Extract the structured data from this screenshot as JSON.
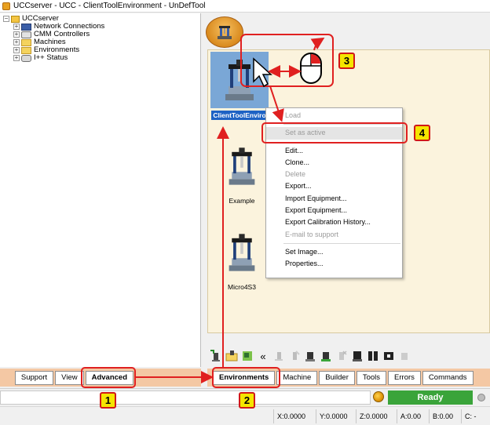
{
  "window": {
    "title": "UCCserver - UCC - ClientToolEnvironment - UnDefTool"
  },
  "tree": {
    "root": "UCCserver",
    "items": [
      {
        "label": "Network Connections",
        "icon": "network-icon"
      },
      {
        "label": "CMM Controllers",
        "icon": "controller-icon"
      },
      {
        "label": "Machines",
        "icon": "folder-icon"
      },
      {
        "label": "Environments",
        "icon": "folder-icon"
      },
      {
        "label": "I++ Status",
        "icon": "status-icon"
      }
    ]
  },
  "environments": [
    {
      "label": "ClientToolEnviro",
      "selected": true
    },
    {
      "label": "Example",
      "selected": false
    },
    {
      "label": "Micro4S3",
      "selected": false
    }
  ],
  "context_menu": {
    "items": [
      {
        "label": "Load",
        "disabled": true
      },
      {
        "label": "Set as active",
        "disabled": true
      },
      {
        "label": "Edit...",
        "disabled": false
      },
      {
        "label": "Clone...",
        "disabled": false
      },
      {
        "label": "Delete",
        "disabled": true
      },
      {
        "label": "Export...",
        "disabled": false
      },
      {
        "label": "Import Equipment...",
        "disabled": false
      },
      {
        "label": "Export Equipment...",
        "disabled": false
      },
      {
        "label": "Export Calibration History...",
        "disabled": false
      },
      {
        "label": "E-mail to support",
        "disabled": true
      },
      {
        "label": "Set Image...",
        "disabled": false
      },
      {
        "label": "Properties...",
        "disabled": false
      }
    ]
  },
  "left_tabs": [
    "Support",
    "View",
    "Advanced"
  ],
  "right_tabs": [
    "Environments",
    "Machine",
    "Builder",
    "Tools",
    "Errors",
    "Commands"
  ],
  "status": {
    "ready": "Ready"
  },
  "coords": [
    "X:0.0000",
    "Y:0.0000",
    "Z:0.0000",
    "A:0.00",
    "B:0.00",
    "C: -"
  ],
  "callouts": [
    "1",
    "2",
    "3",
    "4"
  ],
  "colors": {
    "annotation_red": "#e02020",
    "callout_yellow": "#f5e500",
    "ready_green": "#3aa43a",
    "selection_blue": "#1e62c4",
    "tab_strip": "#f4c8a4"
  }
}
